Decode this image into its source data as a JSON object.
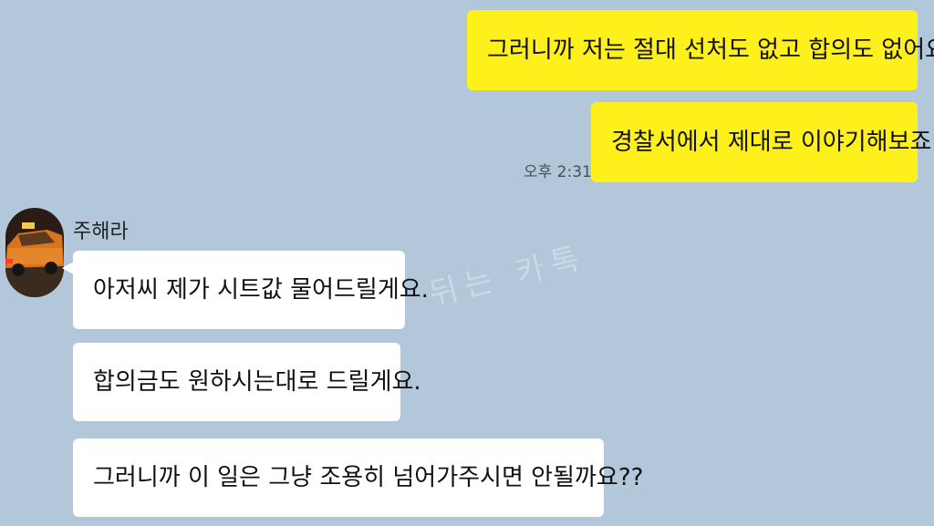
{
  "chat": {
    "messages": [
      {
        "side": "sent",
        "text": "그러니까 저는 절대 선처도 없고 합의도 없어요."
      },
      {
        "side": "sent",
        "text": "경찰서에서 제대로 이야기해보죠.",
        "time": "오후 2:31"
      },
      {
        "side": "received",
        "text": "아저씨 제가 시트값 물어드릴게요."
      },
      {
        "side": "received",
        "text": "합의금도 원하시는대로 드릴게요."
      },
      {
        "side": "received",
        "text": "그러니까 이 일은 그냥 조용히 넘어가주시면 안될까요??"
      }
    ]
  },
  "sender": {
    "name": "주해라",
    "avatar_icon": "taxi-avatar-icon"
  },
  "watermark": {
    "text": "뒤는 카톡"
  },
  "colors": {
    "background": "#b2c7d9",
    "sent_bubble": "#fef01b",
    "received_bubble": "#ffffff"
  }
}
